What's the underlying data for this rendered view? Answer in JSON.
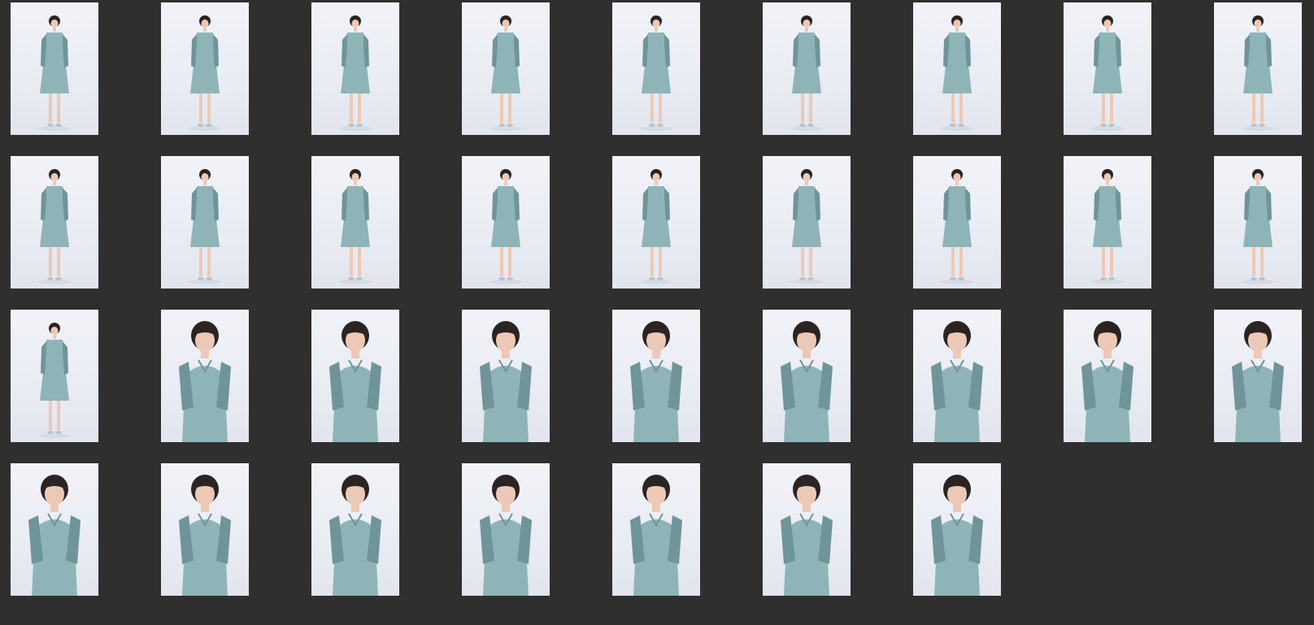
{
  "gallery": {
    "photos": [
      {
        "pose": "full"
      },
      {
        "pose": "full"
      },
      {
        "pose": "full"
      },
      {
        "pose": "full"
      },
      {
        "pose": "full"
      },
      {
        "pose": "full"
      },
      {
        "pose": "full"
      },
      {
        "pose": "full"
      },
      {
        "pose": "full"
      },
      {
        "pose": "full"
      },
      {
        "pose": "full"
      },
      {
        "pose": "full"
      },
      {
        "pose": "full"
      },
      {
        "pose": "full"
      },
      {
        "pose": "full"
      },
      {
        "pose": "full"
      },
      {
        "pose": "full"
      },
      {
        "pose": "full"
      },
      {
        "pose": "full"
      },
      {
        "pose": "half"
      },
      {
        "pose": "half"
      },
      {
        "pose": "half"
      },
      {
        "pose": "half"
      },
      {
        "pose": "half"
      },
      {
        "pose": "half"
      },
      {
        "pose": "half"
      },
      {
        "pose": "half"
      },
      {
        "pose": "half"
      },
      {
        "pose": "half"
      },
      {
        "pose": "half"
      },
      {
        "pose": "half"
      },
      {
        "pose": "half"
      },
      {
        "pose": "half"
      },
      {
        "pose": "half"
      }
    ]
  },
  "colors": {
    "background": "#2f2f2f",
    "backdrop": "#eceff5",
    "dress": "#8fb4b8",
    "dress_shade": "#6f9599",
    "hair": "#2b2422",
    "skin": "#ecc9b6"
  }
}
